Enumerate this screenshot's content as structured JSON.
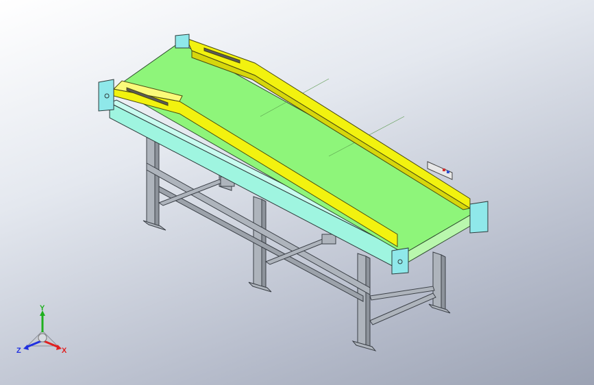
{
  "viewport": {
    "background_top": "#ffffff",
    "background_bottom": "#9ba2b3"
  },
  "model": {
    "belt_color": "#8ef57a",
    "guard_color": "#f2f20f",
    "side_frame_color": "#9ff5e0",
    "end_block_color": "#8fe8ea",
    "leg_color": "#aeb4bc"
  },
  "triad": {
    "x_label": "X",
    "y_label": "Y",
    "z_label": "Z",
    "x_color": "#e02020",
    "y_color": "#1fb01f",
    "z_color": "#2030e0"
  }
}
